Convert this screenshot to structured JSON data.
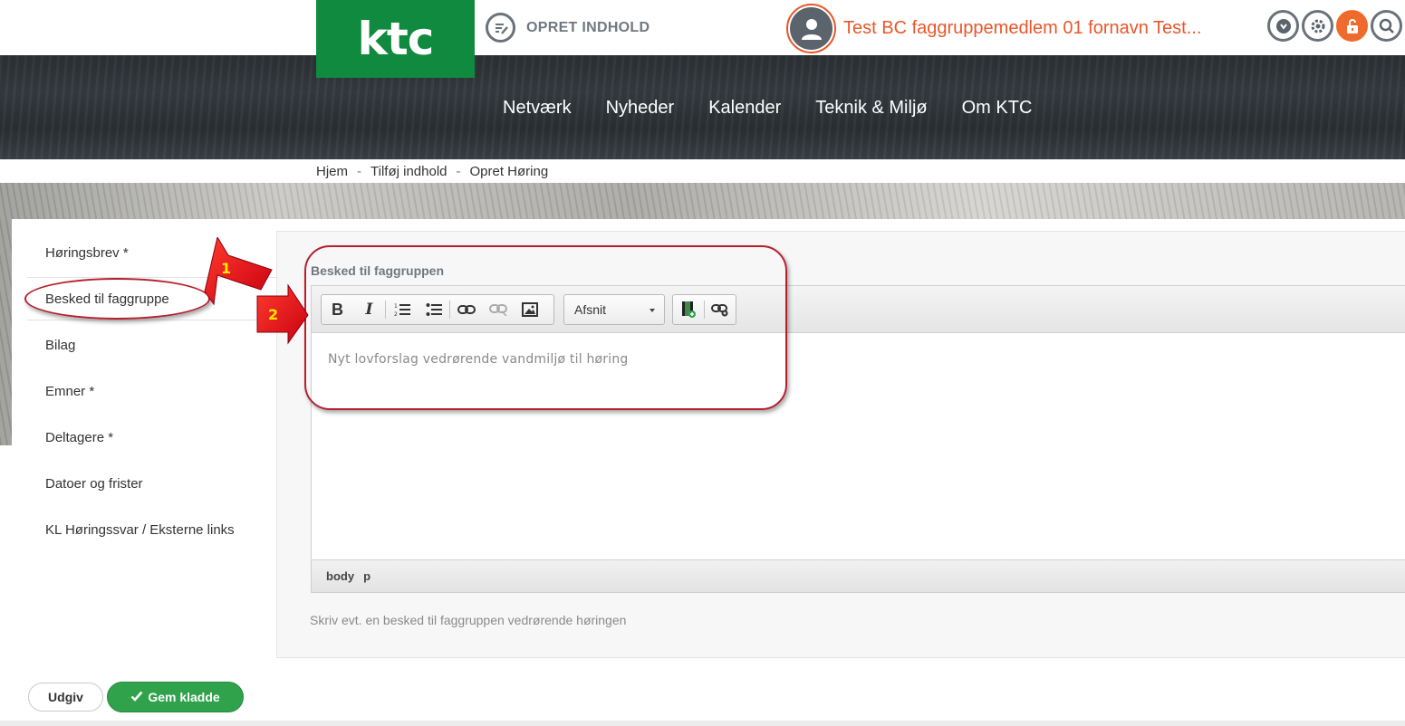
{
  "header": {
    "logo_text": "ktc",
    "create_label": "OPRET INDHOLD",
    "user_name": "Test BC faggruppemedlem 01 fornavn Test...",
    "icons": [
      "download-icon",
      "gear-icon",
      "unlock-icon",
      "search-icon"
    ]
  },
  "nav": {
    "items": [
      "Netværk",
      "Nyheder",
      "Kalender",
      "Teknik & Miljø",
      "Om KTC"
    ]
  },
  "breadcrumb": {
    "items": [
      "Hjem",
      "Tilføj indhold",
      "Opret Høring"
    ],
    "separator": "-"
  },
  "sidebar": {
    "items": [
      "Høringsbrev *",
      "Besked til faggruppe",
      "Bilag",
      "Emner *",
      "Deltagere *",
      "Datoer og frister",
      "KL Høringssvar / Eksterne links"
    ],
    "active_index": 1
  },
  "form": {
    "field_label": "Besked til faggruppen",
    "format_select": "Afsnit",
    "editor_content": "Nyt lovforslag vedrørende vandmiljø til høring",
    "status_path": [
      "body",
      "p"
    ],
    "help_text": "Skriv evt. en besked til faggruppen vedrørende høringen"
  },
  "actions": {
    "publish_label": "Udgiv",
    "save_label": "Gem kladde"
  },
  "annotations": {
    "arrow1": "1",
    "arrow2": "2"
  },
  "colors": {
    "brand_green": "#0f8a3e",
    "accent_orange": "#e8572a",
    "save_green": "#2fa24b",
    "annotation_red": "#b5202e"
  }
}
